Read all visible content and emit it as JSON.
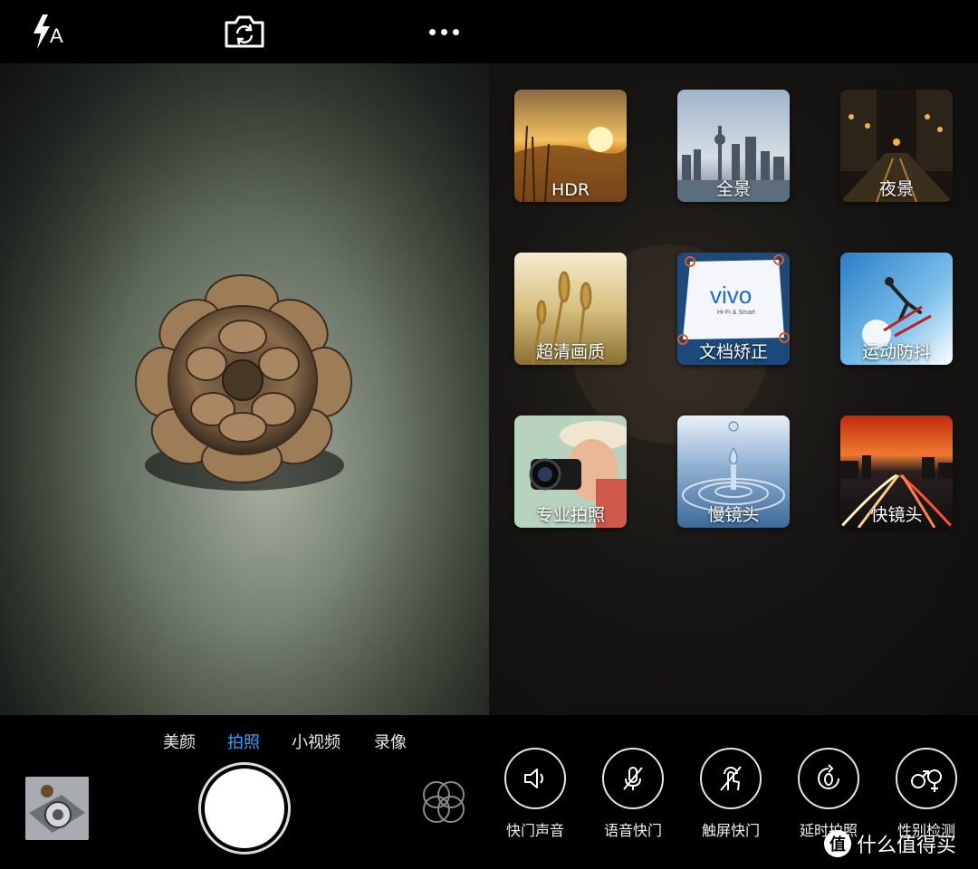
{
  "top_bar": {
    "flash_label": "A",
    "flash_icon": "flash-auto-icon",
    "switch_icon": "camera-switch-icon",
    "more_icon": "more-dots-icon"
  },
  "modes": [
    {
      "label": "HDR",
      "icon": "hdr-sunset-thumbnail"
    },
    {
      "label": "全景",
      "icon": "panorama-city-thumbnail"
    },
    {
      "label": "夜景",
      "icon": "night-street-thumbnail"
    },
    {
      "label": "超清画质",
      "icon": "wheat-field-thumbnail"
    },
    {
      "label": "文档矫正",
      "icon": "document-correction-thumbnail",
      "brand_text": "vivo",
      "brand_sub": "Hi-Fi & Smart"
    },
    {
      "label": "运动防抖",
      "icon": "skier-thumbnail"
    },
    {
      "label": "专业拍照",
      "icon": "photographer-thumbnail"
    },
    {
      "label": "慢镜头",
      "icon": "water-drop-thumbnail"
    },
    {
      "label": "快镜头",
      "icon": "light-trails-thumbnail"
    }
  ],
  "mode_tabs": [
    {
      "label": "美颜",
      "active": false
    },
    {
      "label": "拍照",
      "active": true
    },
    {
      "label": "小视频",
      "active": false
    },
    {
      "label": "录像",
      "active": false
    }
  ],
  "options": [
    {
      "label": "快门声音",
      "icon": "speaker-icon"
    },
    {
      "label": "语音快门",
      "icon": "microphone-off-icon"
    },
    {
      "label": "触屏快门",
      "icon": "touch-icon"
    },
    {
      "label": "延时拍照",
      "icon": "timer-icon"
    },
    {
      "label": "性别检测",
      "icon": "gender-icon"
    }
  ],
  "colors": {
    "accent": "#2ea6ff",
    "background": "#000000"
  },
  "watermark": {
    "badge": "值",
    "text": "什么值得买"
  }
}
